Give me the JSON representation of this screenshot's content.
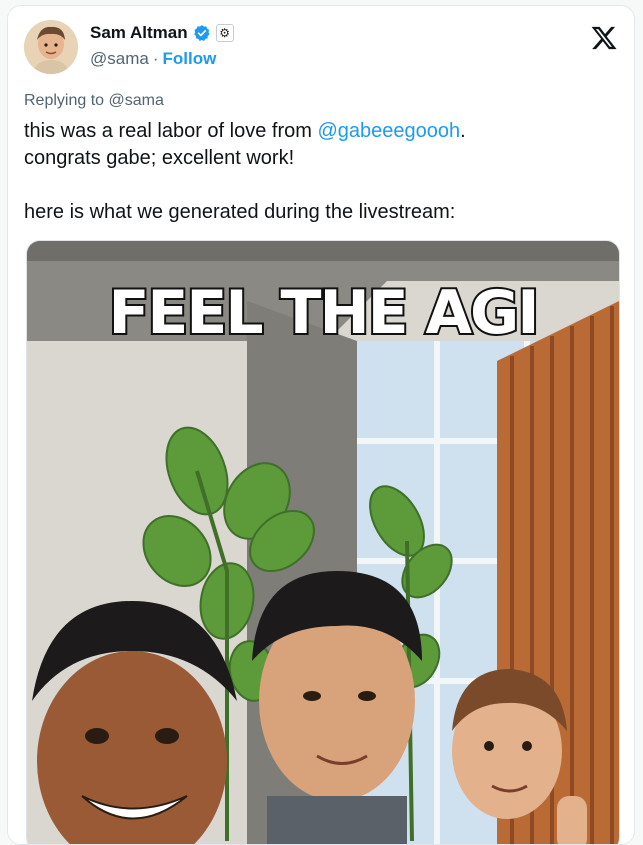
{
  "author": {
    "name": "Sam Altman",
    "handle": "@sama",
    "separator": "·",
    "follow_label": "Follow",
    "org_badge": "⚙",
    "avatar_icon": "avatar-photo"
  },
  "platform_logo": "X",
  "reply_context": "Replying to @sama",
  "tweet": {
    "text_part1": "this was a real labor of love from ",
    "mention": "@gabeeegoooh",
    "text_part2": ".\ncongrats gabe; excellent work!\n\nhere is what we generated during the livestream:"
  },
  "media": {
    "caption": "FEEL THE AGI",
    "alt_icon": "generated-image"
  },
  "colors": {
    "accent": "#1d9bf0",
    "muted": "#536471",
    "text": "#0f1419"
  }
}
